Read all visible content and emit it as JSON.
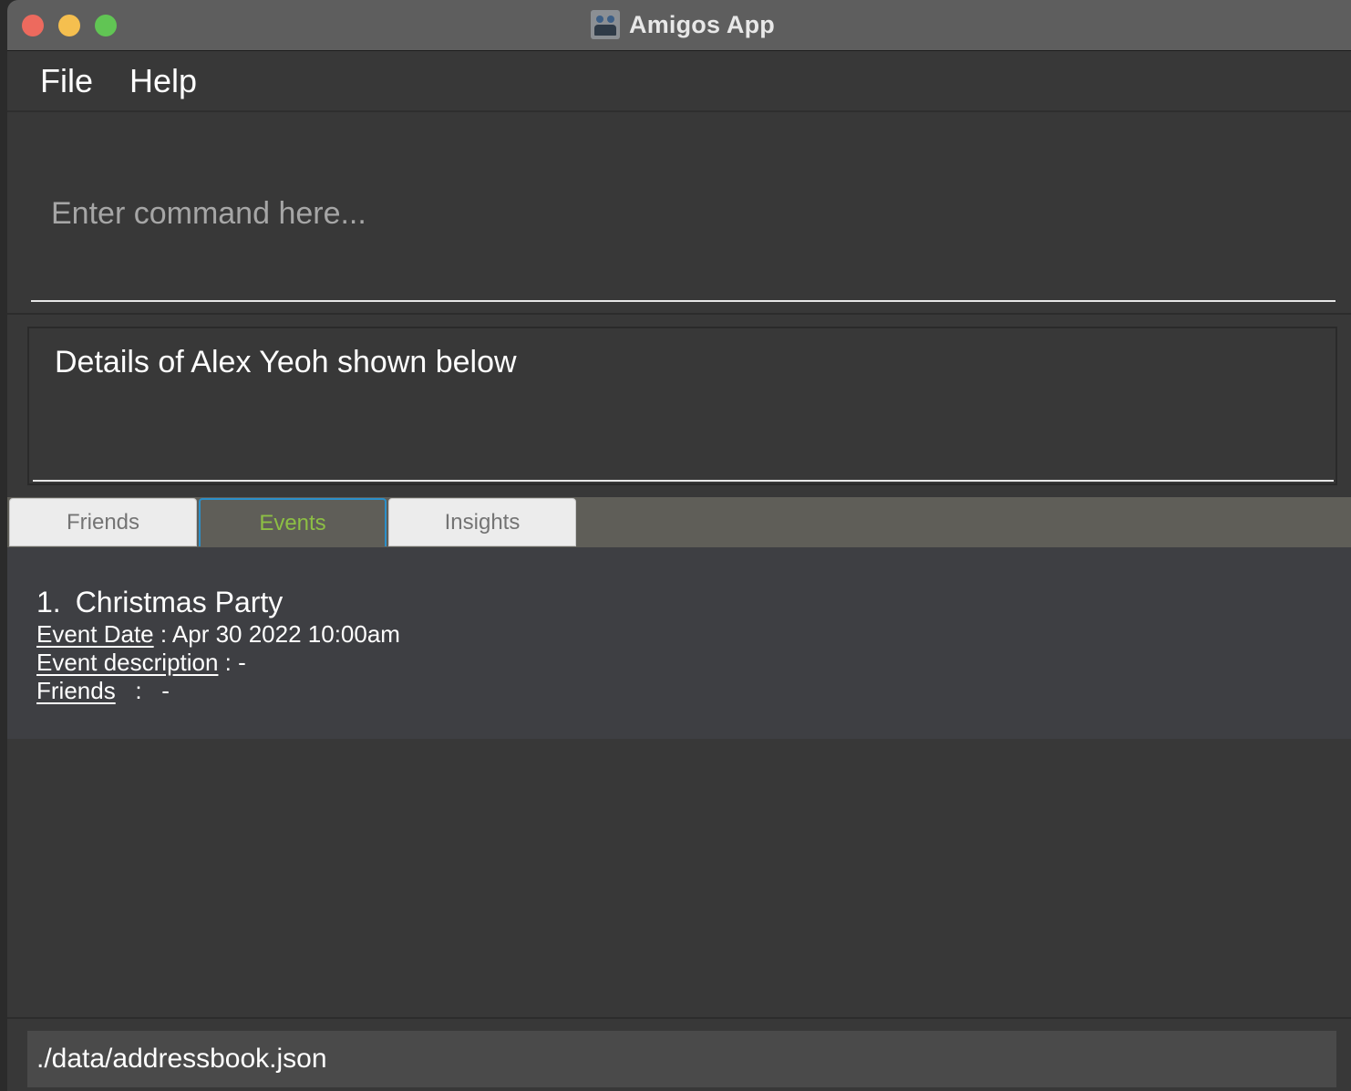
{
  "window": {
    "title": "Amigos App",
    "icon": "amigos-app-icon"
  },
  "menu": {
    "items": [
      {
        "label": "File"
      },
      {
        "label": "Help"
      }
    ]
  },
  "command": {
    "value": "",
    "placeholder": "Enter command here..."
  },
  "result": {
    "text": "Details of Alex Yeoh shown below"
  },
  "tabs": [
    {
      "label": "Friends",
      "selected": false
    },
    {
      "label": "Events",
      "selected": true
    },
    {
      "label": "Insights",
      "selected": false
    }
  ],
  "events": [
    {
      "index": "1.",
      "name": "Christmas Party",
      "date_label": "Event Date",
      "date_sep": " : ",
      "date_value": "Apr 30 2022 10:00am",
      "description_label": "Event description",
      "description_sep": " : ",
      "description_value": "-",
      "friends_label": "Friends",
      "friends_sep": "   :   ",
      "friends_value": "-"
    }
  ],
  "status": {
    "file_path": "./data/addressbook.json"
  },
  "colors": {
    "selected_tab_text": "#8dbf44",
    "selected_tab_border": "#2b8fc9",
    "background": "#383838"
  }
}
